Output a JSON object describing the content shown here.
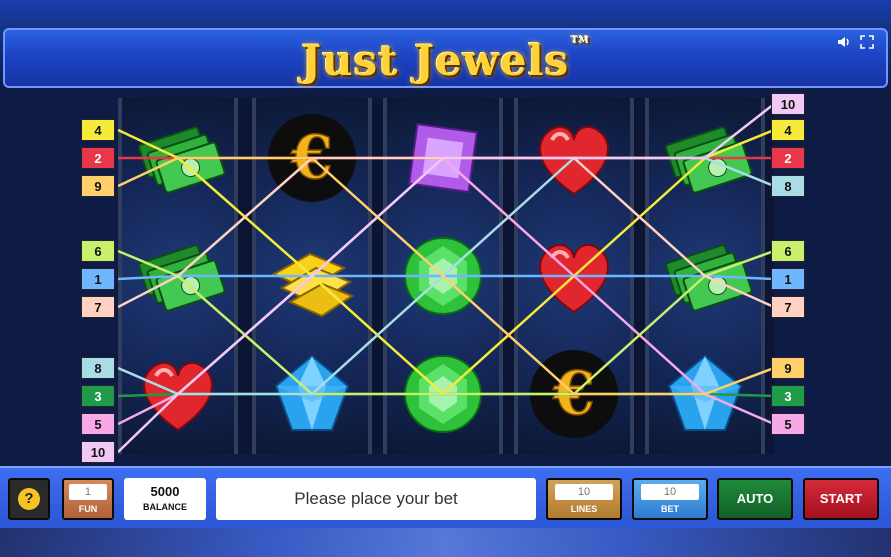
{
  "game": {
    "title": "Just Jewels",
    "trademark": "TM",
    "icons": {
      "sound": "speaker-icon",
      "fullscreen": "fullscreen-icon"
    }
  },
  "reels": [
    [
      "cash",
      "cash",
      "heart"
    ],
    [
      "euro",
      "gold-bars",
      "blue-gem"
    ],
    [
      "purple-gem",
      "green-gem",
      "green-gem"
    ],
    [
      "heart",
      "heart",
      "euro"
    ],
    [
      "cash",
      "cash",
      "blue-gem"
    ]
  ],
  "markers": {
    "left": [
      "4",
      "2",
      "9",
      "6",
      "1",
      "7",
      "8",
      "3",
      "5",
      "10"
    ],
    "right": [
      "10",
      "4",
      "2",
      "8",
      "6",
      "1",
      "7",
      "9",
      "3",
      "5"
    ]
  },
  "line_colors": {
    "1": "#6fb6ff",
    "2": "#e8364a",
    "3": "#1f9a48",
    "4": "#f6ea3a",
    "5": "#f7a8e6",
    "6": "#c8f06a",
    "7": "#ffd1c2",
    "8": "#a9dde6",
    "9": "#ffd06a",
    "10": "#f2c8f5"
  },
  "controls": {
    "help_label": "?",
    "fun": {
      "value": "1",
      "label": "FUN"
    },
    "balance": {
      "value": "5000",
      "label": "BALANCE"
    },
    "message": "Please place your bet",
    "lines": {
      "value": "10",
      "label": "LINES"
    },
    "bet": {
      "value": "10",
      "label": "BET"
    },
    "auto_label": "AUTO",
    "start_label": "START"
  }
}
